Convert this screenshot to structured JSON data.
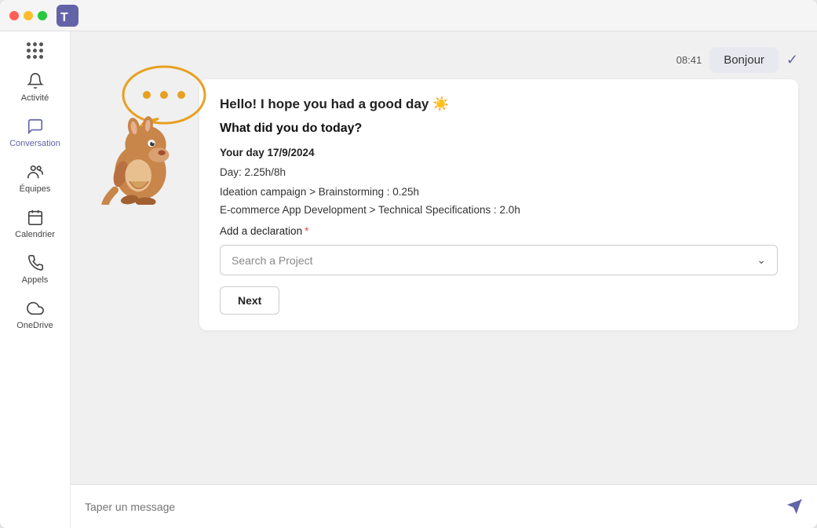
{
  "titlebar": {
    "app_icon_color": "#6264a7"
  },
  "sidebar": {
    "items": [
      {
        "id": "activity",
        "label": "Activité",
        "icon": "bell"
      },
      {
        "id": "conversation",
        "label": "Conversation",
        "icon": "chat",
        "active": true
      },
      {
        "id": "equipes",
        "label": "Équipes",
        "icon": "teams"
      },
      {
        "id": "calendrier",
        "label": "Calendrier",
        "icon": "calendar"
      },
      {
        "id": "appels",
        "label": "Appels",
        "icon": "phone"
      },
      {
        "id": "onedrive",
        "label": "OneDrive",
        "icon": "cloud"
      }
    ]
  },
  "header": {
    "time": "08:41",
    "bonjour_label": "Bonjour"
  },
  "card": {
    "greeting": "Hello! I hope you had a good day ☀️",
    "question": "What did you do today?",
    "day_label": "Your day 17/9/2024",
    "day_total": "Day: 2.25h/8h",
    "entry1": "Ideation campaign > Brainstorming : 0.25h",
    "entry2": "E-commerce App Development > Technical Specifications : 2.0h",
    "add_declaration": "Add a declaration",
    "required_star": "*",
    "search_placeholder": "Search a Project",
    "next_label": "Next"
  },
  "input_bar": {
    "placeholder": "Taper un message"
  }
}
